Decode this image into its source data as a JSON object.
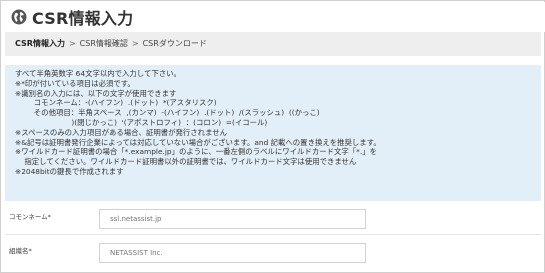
{
  "page_title": "CSR情報入力",
  "breadcrumb": {
    "items": [
      "CSR情報入力",
      "CSR情報確認",
      "CSRダウンロード"
    ],
    "separator": ">"
  },
  "notice_lines": [
    "すべて半角英数字 64文字以内で入力して下さい。",
    "※*印が付いている項目は必須です。",
    "※識別名の入力には、以下の文字が使用できます",
    "        コモンネーム：-(ハイフン)  .(ドット)  *(アスタリスク)",
    "        その他項目：半角スペース  ,(カンマ)  -(ハイフン)  .(ドット)  /(スラッシュ)  ((かっこ)",
    "                        )(閉じかっこ)  '(アポストロフィ)  ：(コロン)  =(イコール)",
    "※スペースのみの入力項目がある場合、証明書が発行されません",
    "※&記号は証明書発行企業によっては対応していない場合がございます。and 記載への置き換えを推奨します。",
    "※ワイルドカード証明書の場合「*.example.jp」のように、一番左側のラベルにワイルドカード文字「*.」を",
    "    指定してください。ワイルドカード証明書以外の証明書では、ワイルドカード文字は使用できません",
    "※2048bitの鍵長で作成されます"
  ],
  "form": {
    "common_name": {
      "label": "コモンネーム*",
      "placeholder": "ssl.netassist.jp"
    },
    "organization": {
      "label": "組織名*",
      "placeholder": "NETASSIST Inc."
    }
  },
  "colors": {
    "notice_bg": "#e3eff8",
    "breadcrumb_bg": "#eeeeee"
  }
}
